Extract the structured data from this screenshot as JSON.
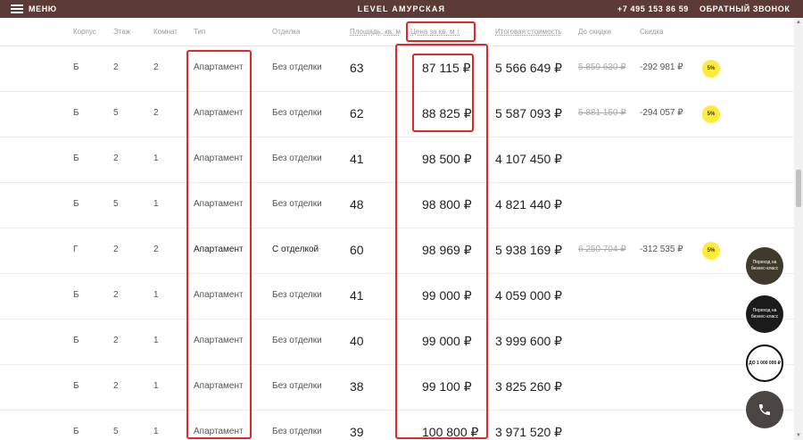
{
  "topbar": {
    "menu_label": "МЕНЮ",
    "title": "LEVEL АМУРСКАЯ",
    "phone": "+7 495 153 86 59",
    "callback": "ОБРАТНЫЙ ЗВОНОК"
  },
  "table": {
    "headers": {
      "building": "Корпус",
      "floor": "Этаж",
      "rooms": "Комнат",
      "type": "Тип",
      "finish": "Отделка",
      "area": "Площадь, кв. м",
      "price_sqm": "Цена за кв. м ↑",
      "total": "Итоговая стоимость",
      "before_discount": "До скидки",
      "discount": "Скидка"
    },
    "rows": [
      {
        "building": "Б",
        "floor": "2",
        "rooms": "2",
        "type": "Апартамент",
        "finish": "Без отделки",
        "area": "63",
        "price_sqm": "87 115 ₽",
        "total": "5 566 649 ₽",
        "old_price": "5 859 630 ₽",
        "discount": "-292 981 ₽",
        "badge": "5%"
      },
      {
        "building": "Б",
        "floor": "5",
        "rooms": "2",
        "type": "Апартамент",
        "finish": "Без отделки",
        "area": "62",
        "price_sqm": "88 825 ₽",
        "total": "5 587 093 ₽",
        "old_price": "5 881 150 ₽",
        "discount": "-294 057 ₽",
        "badge": "5%"
      },
      {
        "building": "Б",
        "floor": "2",
        "rooms": "1",
        "type": "Апартамент",
        "finish": "Без отделки",
        "area": "41",
        "price_sqm": "98 500 ₽",
        "total": "4 107 450 ₽"
      },
      {
        "building": "Б",
        "floor": "5",
        "rooms": "1",
        "type": "Апартамент",
        "finish": "Без отделки",
        "area": "48",
        "price_sqm": "98 800 ₽",
        "total": "4 821 440 ₽"
      },
      {
        "building": "Г",
        "floor": "2",
        "rooms": "2",
        "type": "Апартамент",
        "finish": "С отделкой",
        "area": "60",
        "price_sqm": "98 969 ₽",
        "total": "5 938 169 ₽",
        "old_price": "6 250 704 ₽",
        "discount": "-312 535 ₽",
        "badge": "5%"
      },
      {
        "building": "Б",
        "floor": "2",
        "rooms": "1",
        "type": "Апартамент",
        "finish": "Без отделки",
        "area": "41",
        "price_sqm": "99 000 ₽",
        "total": "4 059 000 ₽"
      },
      {
        "building": "Б",
        "floor": "2",
        "rooms": "1",
        "type": "Апартамент",
        "finish": "Без отделки",
        "area": "40",
        "price_sqm": "99 000 ₽",
        "total": "3 999 600 ₽"
      },
      {
        "building": "Б",
        "floor": "2",
        "rooms": "1",
        "type": "Апартамент",
        "finish": "Без отделки",
        "area": "38",
        "price_sqm": "99 100 ₽",
        "total": "3 825 260 ₽"
      },
      {
        "building": "Б",
        "floor": "5",
        "rooms": "1",
        "type": "Апартамент",
        "finish": "Без отделки",
        "area": "39",
        "price_sqm": "100 800 ₽",
        "total": "3 971 520 ₽"
      }
    ]
  },
  "floating": {
    "business_1": "Переход на бизнес-класс",
    "business_2": "Переход на бизнес-класс",
    "stamp": "ДО 1 000 000 ₽",
    "call_icon": "phone-icon"
  },
  "colors": {
    "topbar": "#5c3b36",
    "highlight": "#e32626",
    "badge": "#ffeb3b"
  }
}
